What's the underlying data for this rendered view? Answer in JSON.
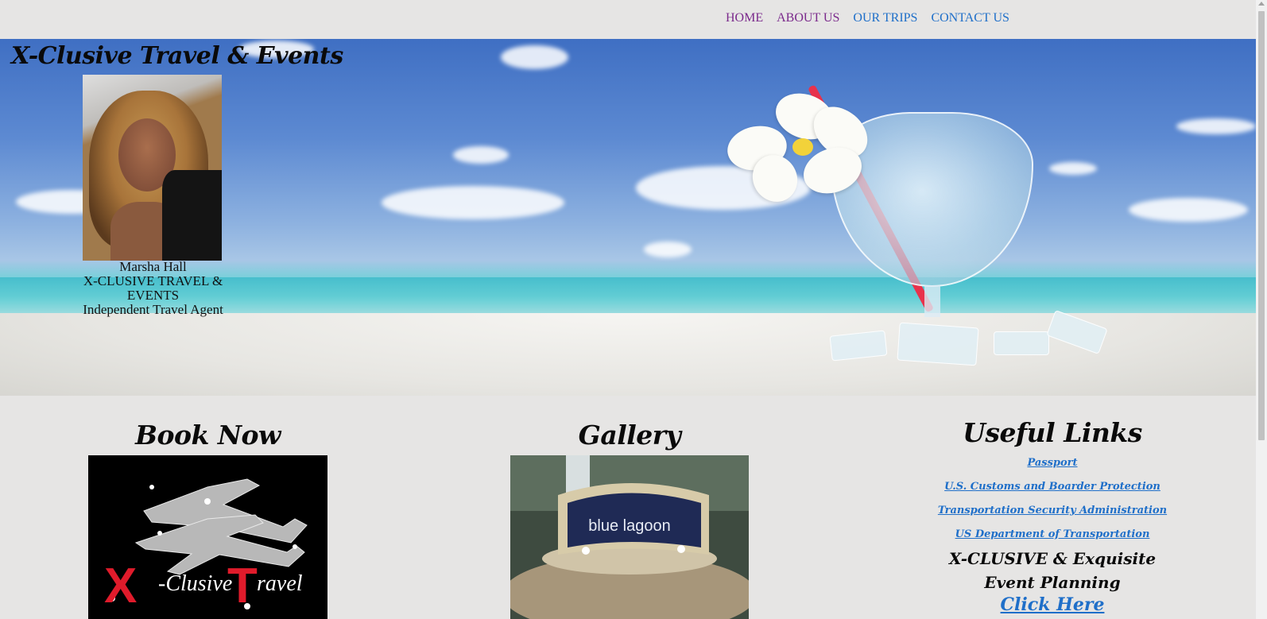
{
  "nav": {
    "items": [
      {
        "label": "HOME",
        "state": "visited"
      },
      {
        "label": "ABOUT US",
        "state": "visited"
      },
      {
        "label": "OUR TRIPS",
        "state": "link"
      },
      {
        "label": "CONTACT US",
        "state": "link"
      }
    ]
  },
  "hero": {
    "site_title": "X-Clusive Travel & Events",
    "agent": {
      "name": "Marsha Hall",
      "company": "X-CLUSIVE TRAVEL & EVENTS",
      "role": "Independent Travel Agent"
    }
  },
  "book": {
    "title": "Book Now",
    "logo_text_x": "X",
    "logo_text_clusive": "-Clusive",
    "logo_text_t": "T",
    "logo_text_ravel": "ravel"
  },
  "gallery": {
    "title": "Gallery",
    "sign_text": "blue lagoon"
  },
  "useful_links": {
    "title": "Useful Links",
    "links": [
      "Passport",
      "U.S. Customs and Boarder Protection",
      "Transportation Security Administration",
      "US Department of Transportation"
    ],
    "tagline_line1": "X-CLUSIVE & Exquisite",
    "tagline_line2": "Event Planning",
    "cta": "Click Here"
  },
  "colors": {
    "page_bg": "#e6e5e4",
    "link_blue": "#1f6fc9",
    "visited_purple": "#7b2a8c",
    "straw_red": "#e8324c"
  }
}
